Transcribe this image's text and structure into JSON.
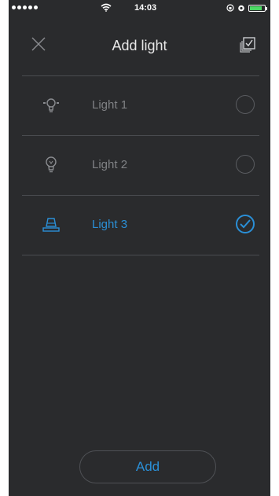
{
  "status_bar": {
    "time": "14:03"
  },
  "nav": {
    "title": "Add light",
    "close_icon": "close-icon",
    "select_all_icon": "select-all-icon"
  },
  "lights": [
    {
      "label": "Light 1",
      "icon": "bulb-radiating-icon",
      "selected": false
    },
    {
      "label": "Light 2",
      "icon": "bulb-icon",
      "selected": false
    },
    {
      "label": "Light 3",
      "icon": "pendant-lamp-icon",
      "selected": true
    }
  ],
  "actions": {
    "add_label": "Add"
  },
  "colors": {
    "background": "#2a2b2d",
    "accent": "#2a8fd6",
    "muted_text": "#808285",
    "divider": "#4a4c50",
    "title_text": "#e8e8e8"
  }
}
